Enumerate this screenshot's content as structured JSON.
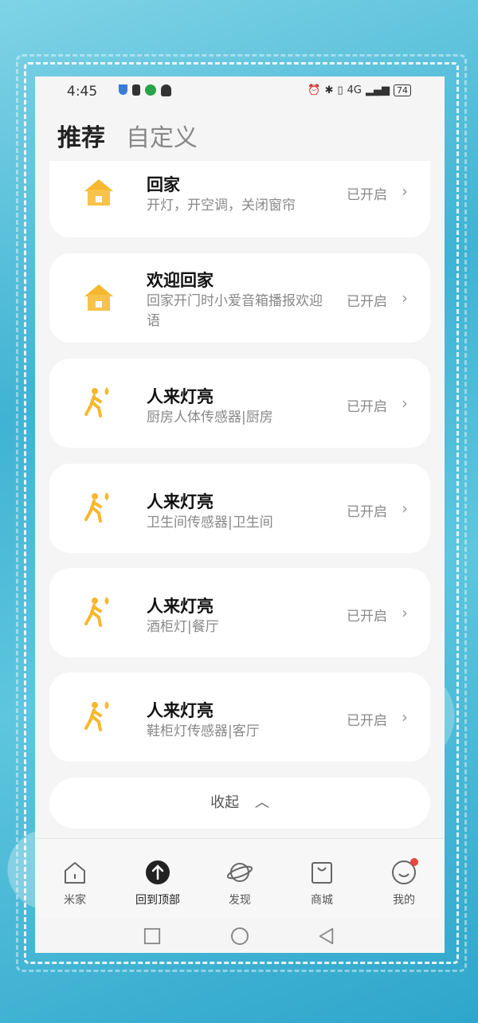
{
  "status_bar": {
    "time": "4:45",
    "battery": "74",
    "network": "4G"
  },
  "tabs": [
    {
      "label": "推荐",
      "active": true
    },
    {
      "label": "自定义",
      "active": false
    }
  ],
  "cards": [
    {
      "icon": "home-icon",
      "title": "回家",
      "subtitle": "开灯，开空调，关闭窗帘",
      "status": "已开启"
    },
    {
      "icon": "home-icon",
      "title": "欢迎回家",
      "subtitle": "回家开门时小爱音箱播报欢迎语",
      "status": "已开启"
    },
    {
      "icon": "person-walking-icon",
      "title": "人来灯亮",
      "subtitle": "厨房人体传感器|厨房",
      "status": "已开启"
    },
    {
      "icon": "person-walking-icon",
      "title": "人来灯亮",
      "subtitle": "卫生间传感器|卫生间",
      "status": "已开启"
    },
    {
      "icon": "person-walking-icon",
      "title": "人来灯亮",
      "subtitle": "酒柜灯|餐厅",
      "status": "已开启"
    },
    {
      "icon": "person-walking-icon",
      "title": "人来灯亮",
      "subtitle": "鞋柜灯传感器|客厅",
      "status": "已开启"
    }
  ],
  "collapse": {
    "label": "收起"
  },
  "bottom_nav": [
    {
      "label": "米家",
      "icon": "home-outline-icon"
    },
    {
      "label": "回到顶部",
      "icon": "arrow-up-icon"
    },
    {
      "label": "发现",
      "icon": "planet-icon"
    },
    {
      "label": "商城",
      "icon": "shopping-bag-icon"
    },
    {
      "label": "我的",
      "icon": "smiley-icon"
    }
  ],
  "colors": {
    "accent": "#F5B82E",
    "badge": "#E8453C"
  }
}
